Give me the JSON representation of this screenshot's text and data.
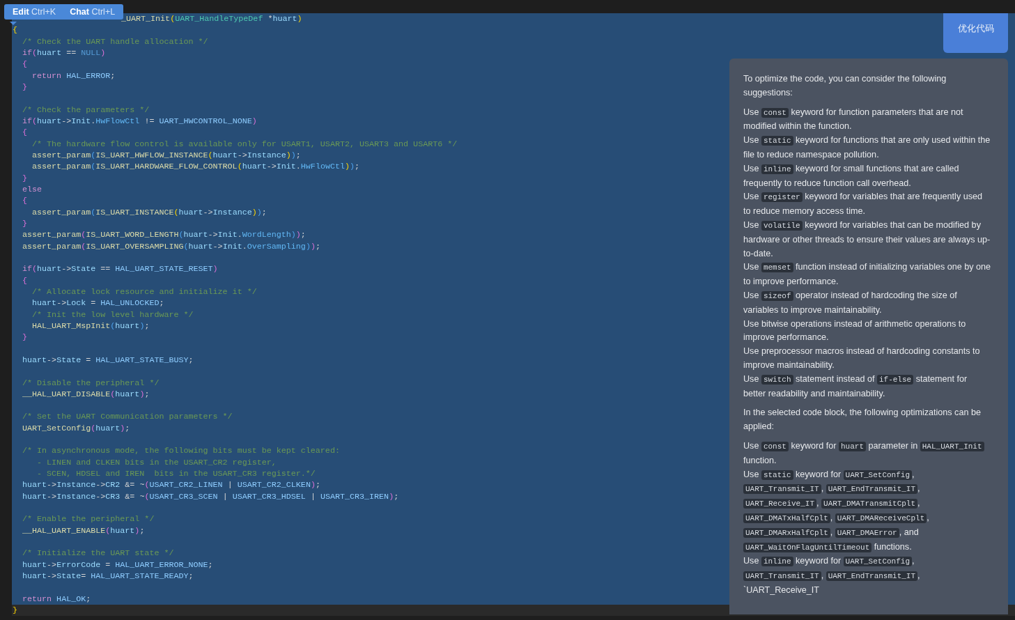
{
  "popup": {
    "actions": [
      {
        "label": "Edit",
        "shortcut": "Ctrl+K"
      },
      {
        "label": "Chat",
        "shortcut": "Ctrl+L"
      }
    ]
  },
  "code": {
    "lines": [
      {
        "selected": true,
        "covered": true,
        "tokens": [
          {
            "text": "_UART_Init",
            "kind": "fn"
          },
          {
            "text": "(",
            "kind": "b1"
          },
          {
            "text": "UART_HandleTypeDef",
            "kind": "type"
          },
          {
            "text": " *",
            "kind": "plain"
          },
          {
            "text": "huart",
            "kind": "var"
          },
          {
            "text": ")",
            "kind": "b1"
          }
        ]
      },
      {
        "selected": true,
        "tokens": [
          {
            "text": "{",
            "kind": "b1"
          }
        ]
      },
      {
        "selected": true,
        "tokens": [
          {
            "text": "  /* Check the UART handle allocation */",
            "kind": "comment"
          }
        ]
      },
      {
        "selected": true,
        "tokens": [
          {
            "text": "  if",
            "kind": "kw"
          },
          {
            "text": "(",
            "kind": "b2"
          },
          {
            "text": "huart",
            "kind": "var"
          },
          {
            "text": " == ",
            "kind": "plain"
          },
          {
            "text": "NULL",
            "kind": "lit"
          },
          {
            "text": ")",
            "kind": "b2"
          }
        ]
      },
      {
        "selected": true,
        "tokens": [
          {
            "text": "  {",
            "kind": "b2"
          }
        ]
      },
      {
        "selected": true,
        "tokens": [
          {
            "text": "    return",
            "kind": "kw"
          },
          {
            "text": " HAL_ERROR",
            "kind": "const"
          },
          {
            "text": ";",
            "kind": "plain"
          }
        ]
      },
      {
        "selected": true,
        "tokens": [
          {
            "text": "  }",
            "kind": "b2"
          }
        ]
      },
      {
        "selected": true
      },
      {
        "selected": true,
        "tokens": [
          {
            "text": "  /* Check the parameters */",
            "kind": "comment"
          }
        ]
      },
      {
        "selected": true,
        "tokens": [
          {
            "text": "  if",
            "kind": "kw"
          },
          {
            "text": "(",
            "kind": "b2"
          },
          {
            "text": "huart",
            "kind": "var"
          },
          {
            "text": "->",
            "kind": "plain"
          },
          {
            "text": "Init",
            "kind": "var"
          },
          {
            "text": ".",
            "kind": "plain"
          },
          {
            "text": "HwFlowCtl",
            "kind": "member"
          },
          {
            "text": " != ",
            "kind": "plain"
          },
          {
            "text": "UART_HWCONTROL_NONE",
            "kind": "const"
          },
          {
            "text": ")",
            "kind": "b2"
          }
        ]
      },
      {
        "selected": true,
        "tokens": [
          {
            "text": "  {",
            "kind": "b2"
          }
        ]
      },
      {
        "selected": true,
        "tokens": [
          {
            "text": "    /* The hardware flow control is available only for USART1, USART2, USART3 and USART6 */",
            "kind": "comment"
          }
        ]
      },
      {
        "selected": true,
        "tokens": [
          {
            "text": "    assert_param",
            "kind": "fn"
          },
          {
            "text": "(",
            "kind": "b3"
          },
          {
            "text": "IS_UART_HWFLOW_INSTANCE",
            "kind": "fn"
          },
          {
            "text": "(",
            "kind": "b1"
          },
          {
            "text": "huart",
            "kind": "var"
          },
          {
            "text": "->",
            "kind": "plain"
          },
          {
            "text": "Instance",
            "kind": "var"
          },
          {
            "text": ")",
            "kind": "b1"
          },
          {
            "text": ")",
            "kind": "b3"
          },
          {
            "text": ";",
            "kind": "plain"
          }
        ]
      },
      {
        "selected": true,
        "tokens": [
          {
            "text": "    assert_param",
            "kind": "fn"
          },
          {
            "text": "(",
            "kind": "b3"
          },
          {
            "text": "IS_UART_HARDWARE_FLOW_CONTROL",
            "kind": "fn"
          },
          {
            "text": "(",
            "kind": "b1"
          },
          {
            "text": "huart",
            "kind": "var"
          },
          {
            "text": "->",
            "kind": "plain"
          },
          {
            "text": "Init",
            "kind": "var"
          },
          {
            "text": ".",
            "kind": "plain"
          },
          {
            "text": "HwFlowCtl",
            "kind": "member"
          },
          {
            "text": ")",
            "kind": "b1"
          },
          {
            "text": ")",
            "kind": "b3"
          },
          {
            "text": ";",
            "kind": "plain"
          }
        ]
      },
      {
        "selected": true,
        "tokens": [
          {
            "text": "  }",
            "kind": "b2"
          }
        ]
      },
      {
        "selected": true,
        "tokens": [
          {
            "text": "  else",
            "kind": "kw"
          }
        ]
      },
      {
        "selected": true,
        "tokens": [
          {
            "text": "  {",
            "kind": "b2"
          }
        ]
      },
      {
        "selected": true,
        "tokens": [
          {
            "text": "    assert_param",
            "kind": "fn"
          },
          {
            "text": "(",
            "kind": "b3"
          },
          {
            "text": "IS_UART_INSTANCE",
            "kind": "fn"
          },
          {
            "text": "(",
            "kind": "b1"
          },
          {
            "text": "huart",
            "kind": "var"
          },
          {
            "text": "->",
            "kind": "plain"
          },
          {
            "text": "Instance",
            "kind": "var"
          },
          {
            "text": ")",
            "kind": "b1"
          },
          {
            "text": ")",
            "kind": "b3"
          },
          {
            "text": ";",
            "kind": "plain"
          }
        ]
      },
      {
        "selected": true,
        "tokens": [
          {
            "text": "  }",
            "kind": "b2"
          }
        ]
      },
      {
        "selected": true,
        "tokens": [
          {
            "text": "  assert_param",
            "kind": "fn"
          },
          {
            "text": "(",
            "kind": "b2"
          },
          {
            "text": "IS_UART_WORD_LENGTH",
            "kind": "fn"
          },
          {
            "text": "(",
            "kind": "b3"
          },
          {
            "text": "huart",
            "kind": "var"
          },
          {
            "text": "->",
            "kind": "plain"
          },
          {
            "text": "Init",
            "kind": "var"
          },
          {
            "text": ".",
            "kind": "plain"
          },
          {
            "text": "WordLength",
            "kind": "member"
          },
          {
            "text": ")",
            "kind": "b3"
          },
          {
            "text": ")",
            "kind": "b2"
          },
          {
            "text": ";",
            "kind": "plain"
          }
        ]
      },
      {
        "selected": true,
        "tokens": [
          {
            "text": "  assert_param",
            "kind": "fn"
          },
          {
            "text": "(",
            "kind": "b2"
          },
          {
            "text": "IS_UART_OVERSAMPLING",
            "kind": "fn"
          },
          {
            "text": "(",
            "kind": "b3"
          },
          {
            "text": "huart",
            "kind": "var"
          },
          {
            "text": "->",
            "kind": "plain"
          },
          {
            "text": "Init",
            "kind": "var"
          },
          {
            "text": ".",
            "kind": "plain"
          },
          {
            "text": "OverSampling",
            "kind": "member"
          },
          {
            "text": ")",
            "kind": "b3"
          },
          {
            "text": ")",
            "kind": "b2"
          },
          {
            "text": ";",
            "kind": "plain"
          }
        ]
      },
      {
        "selected": true
      },
      {
        "selected": true,
        "tokens": [
          {
            "text": "  if",
            "kind": "kw"
          },
          {
            "text": "(",
            "kind": "b2"
          },
          {
            "text": "huart",
            "kind": "var"
          },
          {
            "text": "->",
            "kind": "plain"
          },
          {
            "text": "State",
            "kind": "var"
          },
          {
            "text": " == ",
            "kind": "plain"
          },
          {
            "text": "HAL_UART_STATE_RESET",
            "kind": "const"
          },
          {
            "text": ")",
            "kind": "b2"
          }
        ]
      },
      {
        "selected": true,
        "tokens": [
          {
            "text": "  {",
            "kind": "b2"
          }
        ]
      },
      {
        "selected": true,
        "tokens": [
          {
            "text": "    /* Allocate lock resource and initialize it */",
            "kind": "comment"
          }
        ]
      },
      {
        "selected": true,
        "tokens": [
          {
            "text": "    huart",
            "kind": "var"
          },
          {
            "text": "->",
            "kind": "plain"
          },
          {
            "text": "Lock",
            "kind": "var"
          },
          {
            "text": " = ",
            "kind": "plain"
          },
          {
            "text": "HAL_UNLOCKED",
            "kind": "const"
          },
          {
            "text": ";",
            "kind": "plain"
          }
        ]
      },
      {
        "selected": true,
        "tokens": [
          {
            "text": "    /* Init the low level hardware */",
            "kind": "comment"
          }
        ]
      },
      {
        "selected": true,
        "tokens": [
          {
            "text": "    HAL_UART_MspInit",
            "kind": "fn"
          },
          {
            "text": "(",
            "kind": "b3"
          },
          {
            "text": "huart",
            "kind": "var"
          },
          {
            "text": ")",
            "kind": "b3"
          },
          {
            "text": ";",
            "kind": "plain"
          }
        ]
      },
      {
        "selected": true,
        "tokens": [
          {
            "text": "  }",
            "kind": "b2"
          }
        ]
      },
      {
        "selected": true
      },
      {
        "selected": true,
        "tokens": [
          {
            "text": "  huart",
            "kind": "var"
          },
          {
            "text": "->",
            "kind": "plain"
          },
          {
            "text": "State",
            "kind": "var"
          },
          {
            "text": " = ",
            "kind": "plain"
          },
          {
            "text": "HAL_UART_STATE_BUSY",
            "kind": "const"
          },
          {
            "text": ";",
            "kind": "plain"
          }
        ]
      },
      {
        "selected": true
      },
      {
        "selected": true,
        "tokens": [
          {
            "text": "  /* Disable the peripheral */",
            "kind": "comment"
          }
        ]
      },
      {
        "selected": true,
        "tokens": [
          {
            "text": "  __HAL_UART_DISABLE",
            "kind": "fn"
          },
          {
            "text": "(",
            "kind": "b2"
          },
          {
            "text": "huart",
            "kind": "var"
          },
          {
            "text": ")",
            "kind": "b2"
          },
          {
            "text": ";",
            "kind": "plain"
          }
        ]
      },
      {
        "selected": true
      },
      {
        "selected": true,
        "tokens": [
          {
            "text": "  /* Set the UART Communication parameters */",
            "kind": "comment"
          }
        ]
      },
      {
        "selected": true,
        "tokens": [
          {
            "text": "  UART_SetConfig",
            "kind": "fn"
          },
          {
            "text": "(",
            "kind": "b2"
          },
          {
            "text": "huart",
            "kind": "var"
          },
          {
            "text": ")",
            "kind": "b2"
          },
          {
            "text": ";",
            "kind": "plain"
          }
        ]
      },
      {
        "selected": true
      },
      {
        "selected": true,
        "tokens": [
          {
            "text": "  /* In asynchronous mode, the following bits must be kept cleared:",
            "kind": "comment"
          }
        ]
      },
      {
        "selected": true,
        "tokens": [
          {
            "text": "     - LINEN and CLKEN bits in the USART_CR2 register,",
            "kind": "comment"
          }
        ]
      },
      {
        "selected": true,
        "tokens": [
          {
            "text": "     - SCEN, HDSEL and IREN  bits in the USART_CR3 register.*/",
            "kind": "comment"
          }
        ]
      },
      {
        "selected": true,
        "tokens": [
          {
            "text": "  huart",
            "kind": "var"
          },
          {
            "text": "->",
            "kind": "plain"
          },
          {
            "text": "Instance",
            "kind": "var"
          },
          {
            "text": "->",
            "kind": "plain"
          },
          {
            "text": "CR2",
            "kind": "var"
          },
          {
            "text": " &= ~",
            "kind": "plain"
          },
          {
            "text": "(",
            "kind": "b2"
          },
          {
            "text": "USART_CR2_LINEN",
            "kind": "const"
          },
          {
            "text": " | ",
            "kind": "plain"
          },
          {
            "text": "USART_CR2_CLKEN",
            "kind": "const"
          },
          {
            "text": ")",
            "kind": "b2"
          },
          {
            "text": ";",
            "kind": "plain"
          }
        ]
      },
      {
        "selected": true,
        "tokens": [
          {
            "text": "  huart",
            "kind": "var"
          },
          {
            "text": "->",
            "kind": "plain"
          },
          {
            "text": "Instance",
            "kind": "var"
          },
          {
            "text": "->",
            "kind": "plain"
          },
          {
            "text": "CR3",
            "kind": "var"
          },
          {
            "text": " &= ~",
            "kind": "plain"
          },
          {
            "text": "(",
            "kind": "b2"
          },
          {
            "text": "USART_CR3_SCEN",
            "kind": "const"
          },
          {
            "text": " | ",
            "kind": "plain"
          },
          {
            "text": "USART_CR3_HDSEL",
            "kind": "const"
          },
          {
            "text": " | ",
            "kind": "plain"
          },
          {
            "text": "USART_CR3_IREN",
            "kind": "const"
          },
          {
            "text": ")",
            "kind": "b2"
          },
          {
            "text": ";",
            "kind": "plain"
          }
        ]
      },
      {
        "selected": true
      },
      {
        "selected": true,
        "tokens": [
          {
            "text": "  /* Enable the peripheral */",
            "kind": "comment"
          }
        ]
      },
      {
        "selected": true,
        "tokens": [
          {
            "text": "  __HAL_UART_ENABLE",
            "kind": "fn"
          },
          {
            "text": "(",
            "kind": "b2"
          },
          {
            "text": "huart",
            "kind": "var"
          },
          {
            "text": ")",
            "kind": "b2"
          },
          {
            "text": ";",
            "kind": "plain"
          }
        ]
      },
      {
        "selected": true
      },
      {
        "selected": true,
        "tokens": [
          {
            "text": "  /* Initialize the UART state */",
            "kind": "comment"
          }
        ]
      },
      {
        "selected": true,
        "tokens": [
          {
            "text": "  huart",
            "kind": "var"
          },
          {
            "text": "->",
            "kind": "plain"
          },
          {
            "text": "ErrorCode",
            "kind": "var"
          },
          {
            "text": " = ",
            "kind": "plain"
          },
          {
            "text": "HAL_UART_ERROR_NONE",
            "kind": "const"
          },
          {
            "text": ";",
            "kind": "plain"
          }
        ]
      },
      {
        "selected": true,
        "tokens": [
          {
            "text": "  huart",
            "kind": "var"
          },
          {
            "text": "->",
            "kind": "plain"
          },
          {
            "text": "State",
            "kind": "var"
          },
          {
            "text": "= ",
            "kind": "plain"
          },
          {
            "text": "HAL_UART_STATE_READY",
            "kind": "const"
          },
          {
            "text": ";",
            "kind": "plain"
          }
        ]
      },
      {
        "selected": true
      },
      {
        "selected": true,
        "tokens": [
          {
            "text": "  return",
            "kind": "kw"
          },
          {
            "text": " HAL_OK",
            "kind": "const"
          },
          {
            "text": ";",
            "kind": "plain"
          }
        ]
      },
      {
        "selected": false,
        "tokens": [
          {
            "text": "}",
            "kind": "b1"
          }
        ]
      }
    ]
  },
  "chat": {
    "user_message": "优化代码",
    "sections": [
      {
        "items": [
          [
            {
              "text": "To optimize the code, you can consider the following suggestions:"
            }
          ]
        ]
      },
      {
        "items": [
          [
            {
              "text": "Use "
            },
            {
              "code": "const"
            },
            {
              "text": " keyword for function parameters that are not modified within the function."
            }
          ],
          [
            {
              "text": "Use "
            },
            {
              "code": "static"
            },
            {
              "text": " keyword for functions that are only used within the file to reduce namespace pollution."
            }
          ],
          [
            {
              "text": "Use "
            },
            {
              "code": "inline"
            },
            {
              "text": " keyword for small functions that are called frequently to reduce function call overhead."
            }
          ],
          [
            {
              "text": "Use "
            },
            {
              "code": "register"
            },
            {
              "text": " keyword for variables that are frequently used to reduce memory access time."
            }
          ],
          [
            {
              "text": "Use "
            },
            {
              "code": "volatile"
            },
            {
              "text": " keyword for variables that can be modified by hardware or other threads to ensure their values are always up-to-date."
            }
          ],
          [
            {
              "text": "Use "
            },
            {
              "code": "memset"
            },
            {
              "text": " function instead of initializing variables one by one to improve performance."
            }
          ],
          [
            {
              "text": "Use "
            },
            {
              "code": "sizeof"
            },
            {
              "text": " operator instead of hardcoding the size of variables to improve maintainability."
            }
          ],
          [
            {
              "text": "Use bitwise operations instead of arithmetic operations to improve performance."
            }
          ],
          [
            {
              "text": "Use preprocessor macros instead of hardcoding constants to improve maintainability."
            }
          ],
          [
            {
              "text": "Use "
            },
            {
              "code": "switch"
            },
            {
              "text": " statement instead of "
            },
            {
              "code": "if-else"
            },
            {
              "text": " statement for better readability and maintainability."
            }
          ]
        ]
      },
      {
        "items": [
          [
            {
              "text": "In the selected code block, the following optimizations can be applied:"
            }
          ]
        ]
      },
      {
        "items": [
          [
            {
              "text": "Use "
            },
            {
              "code": "const"
            },
            {
              "text": " keyword for "
            },
            {
              "code": "huart"
            },
            {
              "text": " parameter in "
            },
            {
              "code": "HAL_UART_Init"
            },
            {
              "text": " function."
            }
          ],
          [
            {
              "text": "Use "
            },
            {
              "code": "static"
            },
            {
              "text": " keyword for "
            },
            {
              "code": "UART_SetConfig"
            },
            {
              "text": ", "
            },
            {
              "code": "UART_Transmit_IT"
            },
            {
              "text": ", "
            },
            {
              "code": "UART_EndTransmit_IT"
            },
            {
              "text": ", "
            },
            {
              "code": "UART_Receive_IT"
            },
            {
              "text": ", "
            },
            {
              "code": "UART_DMATransmitCplt"
            },
            {
              "text": ", "
            },
            {
              "code": "UART_DMATxHalfCplt"
            },
            {
              "text": ", "
            },
            {
              "code": "UART_DMAReceiveCplt"
            },
            {
              "text": ", "
            },
            {
              "code": "UART_DMARxHalfCplt"
            },
            {
              "text": ", "
            },
            {
              "code": "UART_DMAError"
            },
            {
              "text": ", and "
            },
            {
              "code": "UART_WaitOnFlagUntilTimeout"
            },
            {
              "text": " functions."
            }
          ],
          [
            {
              "text": "Use "
            },
            {
              "code": "inline"
            },
            {
              "text": " keyword for "
            },
            {
              "code": "UART_SetConfig"
            },
            {
              "text": ", "
            },
            {
              "code": "UART_Transmit_IT"
            },
            {
              "text": ", "
            },
            {
              "code": "UART_EndTransmit_IT"
            },
            {
              "text": ","
            }
          ],
          [
            {
              "text": "`UART_Receive_IT"
            }
          ]
        ]
      }
    ]
  }
}
